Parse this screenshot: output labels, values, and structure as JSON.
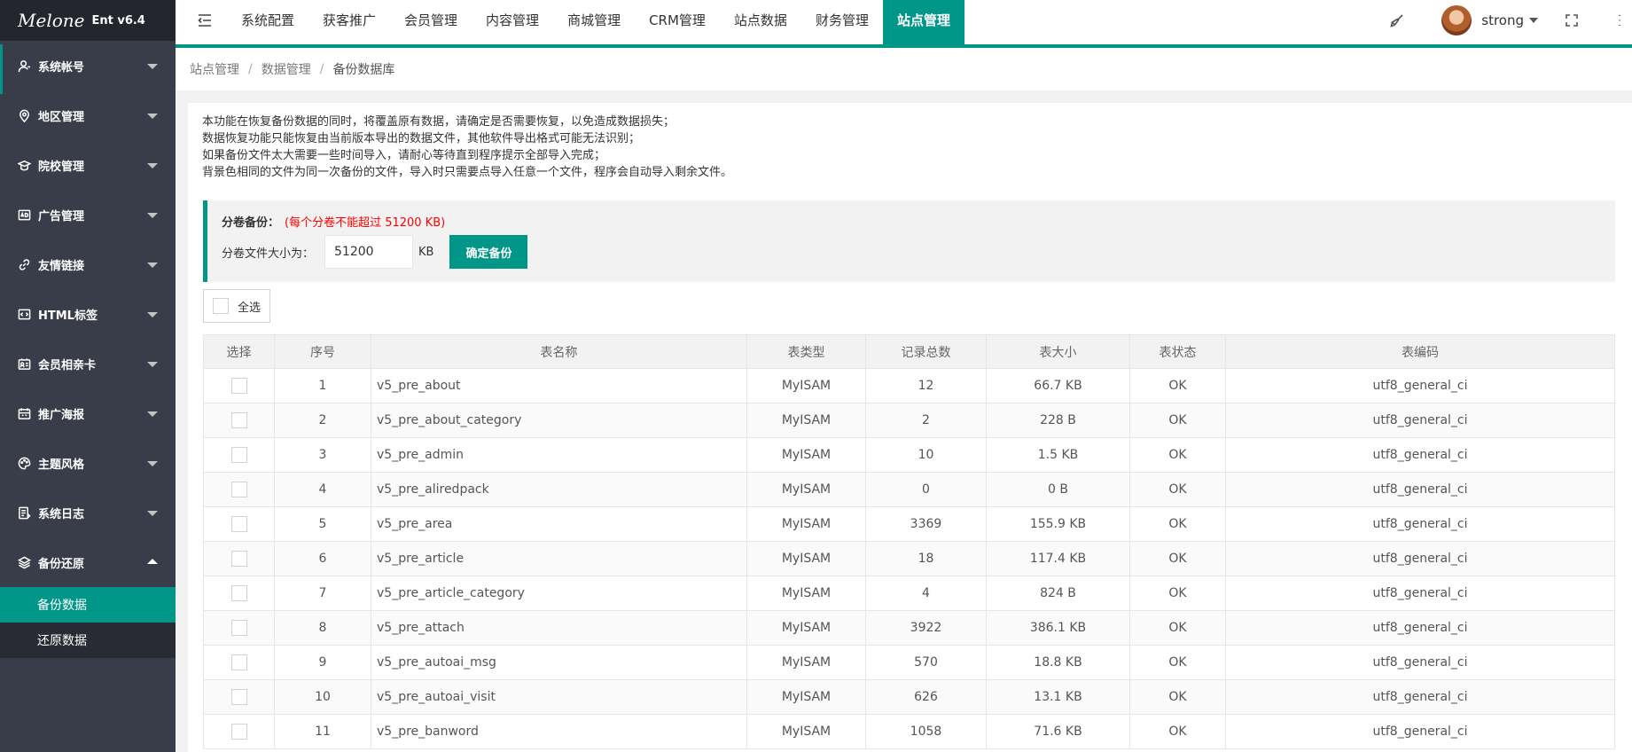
{
  "sidebar": {
    "brand": "Melone",
    "version": "Ent v6.4",
    "items": [
      {
        "label": "系统帐号",
        "icon": "user-icon"
      },
      {
        "label": "地区管理",
        "icon": "location-icon"
      },
      {
        "label": "院校管理",
        "icon": "school-icon"
      },
      {
        "label": "广告管理",
        "icon": "ad-icon"
      },
      {
        "label": "友情链接",
        "icon": "link-icon"
      },
      {
        "label": "HTML标签",
        "icon": "html-icon"
      },
      {
        "label": "会员相亲卡",
        "icon": "card-icon"
      },
      {
        "label": "推广海报",
        "icon": "poster-icon"
      },
      {
        "label": "主题风格",
        "icon": "palette-icon"
      },
      {
        "label": "系统日志",
        "icon": "log-icon"
      },
      {
        "label": "备份还原",
        "icon": "layers-icon"
      }
    ],
    "subitems": [
      {
        "label": "备份数据"
      },
      {
        "label": "还原数据"
      }
    ]
  },
  "topbar": {
    "menus": [
      "系统配置",
      "获客推广",
      "会员管理",
      "内容管理",
      "商城管理",
      "CRM管理",
      "站点数据",
      "财务管理",
      "站点管理"
    ],
    "username": "strong"
  },
  "breadcrumb": [
    "站点管理",
    "数据管理",
    "备份数据库"
  ],
  "notice": [
    "本功能在恢复备份数据的同时，将覆盖原有数据，请确定是否需要恢复，以免造成数据损失；",
    "数据恢复功能只能恢复由当前版本导出的数据文件，其他软件导出格式可能无法识别；",
    "如果备份文件太大需要一些时间导入，请耐心等待直到程序提示全部导入完成；",
    "背景色相同的文件为同一次备份的文件，导入时只需要点导入任意一个文件，程序会自动导入剩余文件。"
  ],
  "backup": {
    "title": "分卷备份：",
    "warning": "(每个分卷不能超过 51200 KB)",
    "size_label": "分卷文件大小为：",
    "size_value": "51200",
    "unit": "KB",
    "submit_label": "确定备份",
    "select_all_label": "全选"
  },
  "table": {
    "headers": [
      "选择",
      "序号",
      "表名称",
      "表类型",
      "记录总数",
      "表大小",
      "表状态",
      "表编码"
    ],
    "rows": [
      {
        "no": "1",
        "name": "v5_pre_about",
        "type": "MyISAM",
        "count": "12",
        "size": "66.7 KB",
        "status": "OK",
        "encoding": "utf8_general_ci"
      },
      {
        "no": "2",
        "name": "v5_pre_about_category",
        "type": "MyISAM",
        "count": "2",
        "size": "228 B",
        "status": "OK",
        "encoding": "utf8_general_ci"
      },
      {
        "no": "3",
        "name": "v5_pre_admin",
        "type": "MyISAM",
        "count": "10",
        "size": "1.5 KB",
        "status": "OK",
        "encoding": "utf8_general_ci"
      },
      {
        "no": "4",
        "name": "v5_pre_aliredpack",
        "type": "MyISAM",
        "count": "0",
        "size": "0 B",
        "status": "OK",
        "encoding": "utf8_general_ci"
      },
      {
        "no": "5",
        "name": "v5_pre_area",
        "type": "MyISAM",
        "count": "3369",
        "size": "155.9 KB",
        "status": "OK",
        "encoding": "utf8_general_ci"
      },
      {
        "no": "6",
        "name": "v5_pre_article",
        "type": "MyISAM",
        "count": "18",
        "size": "117.4 KB",
        "status": "OK",
        "encoding": "utf8_general_ci"
      },
      {
        "no": "7",
        "name": "v5_pre_article_category",
        "type": "MyISAM",
        "count": "4",
        "size": "824 B",
        "status": "OK",
        "encoding": "utf8_general_ci"
      },
      {
        "no": "8",
        "name": "v5_pre_attach",
        "type": "MyISAM",
        "count": "3922",
        "size": "386.1 KB",
        "status": "OK",
        "encoding": "utf8_general_ci"
      },
      {
        "no": "9",
        "name": "v5_pre_autoai_msg",
        "type": "MyISAM",
        "count": "570",
        "size": "18.8 KB",
        "status": "OK",
        "encoding": "utf8_general_ci"
      },
      {
        "no": "10",
        "name": "v5_pre_autoai_visit",
        "type": "MyISAM",
        "count": "626",
        "size": "13.1 KB",
        "status": "OK",
        "encoding": "utf8_general_ci"
      },
      {
        "no": "11",
        "name": "v5_pre_banword",
        "type": "MyISAM",
        "count": "1058",
        "size": "71.6 KB",
        "status": "OK",
        "encoding": "utf8_general_ci"
      }
    ]
  },
  "colors": {
    "accent": "#009688",
    "sidebar": "#393d49",
    "warning": "#ff0000"
  }
}
